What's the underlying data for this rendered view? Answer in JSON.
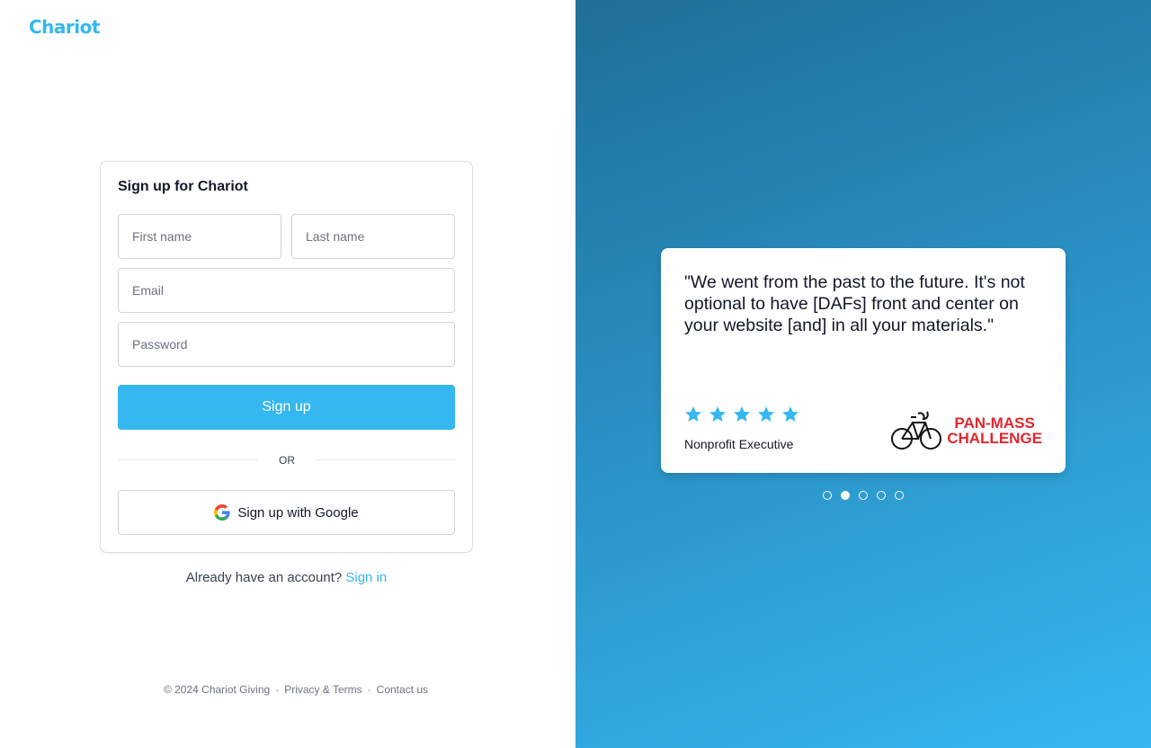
{
  "brand": {
    "logo_text": "Chariot",
    "accent": "#35b7ef"
  },
  "signup_form": {
    "title": "Sign up for Chariot",
    "first_name_placeholder": "First name",
    "last_name_placeholder": "Last name",
    "email_placeholder": "Email",
    "password_placeholder": "Password",
    "submit_label": "Sign up",
    "divider_text": "OR",
    "google_label": "Sign up with Google"
  },
  "signin_prompt": {
    "text": "Already have an account?",
    "link": "Sign in"
  },
  "footer": {
    "copyright": "© 2024 Chariot Giving",
    "privacy": "Privacy & Terms",
    "contact": "Contact us",
    "separator": "·"
  },
  "testimonial": {
    "quote": "\"We went from the past to the future. It's not optional to have [DAFs] front and center on your website [and] in all your materials.\"",
    "rating": 5,
    "rating_max": 5,
    "role": "Nonprofit Executive",
    "org_logo_line1": "PAN-MASS",
    "org_logo_line2": "CHALLENGE",
    "org_logo_color": "#e0262f"
  },
  "carousel": {
    "count": 5,
    "active_index": 1
  }
}
